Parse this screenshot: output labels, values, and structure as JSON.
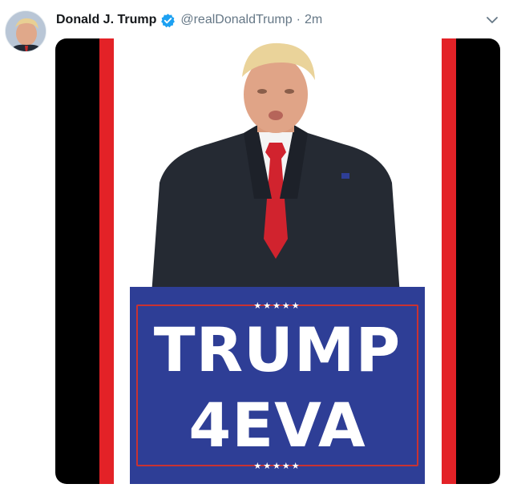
{
  "tweet": {
    "display_name": "Donald J. Trump",
    "handle": "@realDonaldTrump",
    "separator": "·",
    "timestamp": "2m"
  },
  "icons": {
    "verified": "verified-badge-icon",
    "more": "chevron-down-icon"
  },
  "media": {
    "sign_line1": "TRUMP",
    "sign_line2": "4EVA",
    "stars": "★★★★★"
  },
  "colors": {
    "accent_blue": "#1da1f2",
    "stripe_red": "#e32227",
    "sign_blue": "#2e3e96"
  }
}
